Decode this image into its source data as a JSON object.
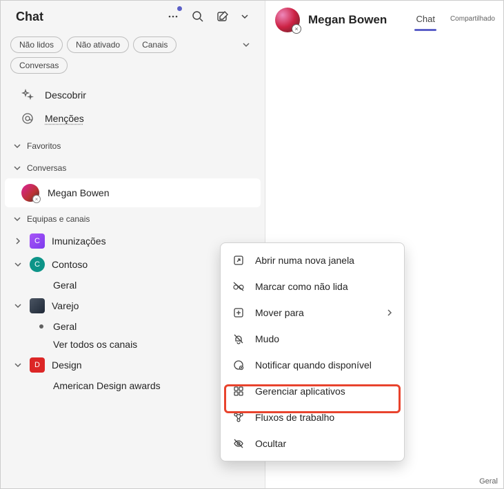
{
  "sidebar": {
    "title": "Chat",
    "filters": {
      "unread": "Não lidos",
      "unactivated": "Não ativado",
      "channels": "Canais",
      "conversations": "Conversas"
    },
    "nav": {
      "discover": "Descobrir",
      "mentions": "Menções"
    },
    "sections": {
      "favorites": "Favoritos",
      "conversations": "Conversas",
      "teams": "Equipas e canais"
    },
    "active_chat": "Megan Bowen",
    "teams": [
      {
        "name": "Imunizações",
        "color": "purple",
        "initial": "C",
        "expanded": false,
        "channels": []
      },
      {
        "name": "Contoso",
        "color": "teal",
        "initial": "C",
        "expanded": true,
        "channels": [
          "Geral"
        ]
      },
      {
        "name": "Varejo",
        "color": "dark",
        "initial": "",
        "expanded": true,
        "channels": [
          "Geral",
          "Ver todos os canais"
        ]
      },
      {
        "name": "Design",
        "color": "red",
        "initial": "D",
        "expanded": true,
        "channels": [
          "American Design awards"
        ]
      }
    ]
  },
  "main": {
    "name": "Megan Bowen",
    "tabs": {
      "chat": "Chat",
      "shared": "Compartilhado"
    }
  },
  "menu": {
    "open_window": "Abrir numa nova janela",
    "mark_unread": "Marcar como não lida",
    "move_to": "Mover para",
    "mute": "Mudo",
    "notify_available": "Notificar quando disponível",
    "manage_apps": "Gerenciar aplicativos",
    "workflows": "Fluxos de trabalho",
    "hide": "Ocultar"
  },
  "footer": "Geral"
}
